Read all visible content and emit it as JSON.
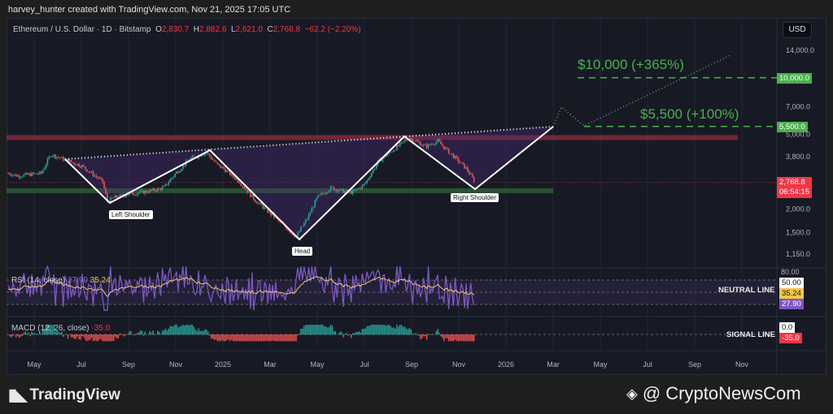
{
  "credit": "harvey_hunter created with TradingView.com, Nov 21, 2025 17:05 UTC",
  "legend": {
    "symbol": "Ethereum / U.S. Dollar · 1D · Bitstamp",
    "o_label": "O",
    "o": "2,830.7",
    "h_label": "H",
    "h": "2,882.6",
    "l_label": "L",
    "l": "2,621.0",
    "c_label": "C",
    "c": "2,768.8",
    "change": "−62.2 (−2.20%)"
  },
  "currency": "USD",
  "price_axis": [
    "14,000.0",
    "7,000.0",
    "5,000.0",
    "3,800.0",
    "2,000.0",
    "1,500.0",
    "1,150.0"
  ],
  "price_tags": {
    "target1": "10,000.0",
    "target2": "5,500.0",
    "last": "2,768.8",
    "countdown": "06:54:15"
  },
  "annotations": {
    "target1": "$10,000 (+365%)",
    "target2": "$5,500 (+100%)",
    "left_shoulder": "Left Shoulder",
    "head": "Head",
    "right_shoulder": "Right Shoulder",
    "neutral_line": "NEUTRAL LINE",
    "signal_line": "SIGNAL LINE"
  },
  "rsi": {
    "title": "RSI (14, close)",
    "value": "27.90",
    "ma": "35.24",
    "axis_top": "80.00",
    "neutral": "50.00"
  },
  "macd": {
    "title": "MACD (12, 26, close)",
    "value": "-35.0",
    "zero": "0.0"
  },
  "time_axis": [
    "May",
    "Jul",
    "Sep",
    "Nov",
    "2025",
    "Mar",
    "May",
    "Jul",
    "Sep",
    "Nov",
    "2026",
    "Mar",
    "May",
    "Jul",
    "Sep",
    "Nov"
  ],
  "footer": {
    "brand": "TradingView",
    "watermark": "@ CryptoNewsCom"
  },
  "colors": {
    "up": "#26a69a",
    "down": "#ef5350",
    "target": "#4caf50",
    "rsi": "#7e57c2",
    "last": "#f23645"
  },
  "chart_data": {
    "type": "candlestick",
    "title": "Ethereum / U.S. Dollar · 1D · Bitstamp",
    "scale": "log",
    "ylim": [
      1100,
      16000
    ],
    "x_unit": "months since May 2024",
    "close_path": [
      [
        -1.1,
        3100
      ],
      [
        -0.7,
        3000
      ],
      [
        0.3,
        3100
      ],
      [
        0.7,
        3900
      ],
      [
        1.2,
        3700
      ],
      [
        2.0,
        3400
      ],
      [
        2.9,
        2800
      ],
      [
        3.1,
        2200
      ],
      [
        3.4,
        2300
      ],
      [
        4,
        2400
      ],
      [
        5,
        2500
      ],
      [
        5.5,
        2600
      ],
      [
        6,
        3100
      ],
      [
        6.6,
        3700
      ],
      [
        7.3,
        4000
      ],
      [
        7.8,
        3400
      ],
      [
        8,
        3300
      ],
      [
        8.7,
        2800
      ],
      [
        9.4,
        2200
      ],
      [
        10,
        1900
      ],
      [
        11.1,
        1420
      ],
      [
        11.6,
        1800
      ],
      [
        12,
        2300
      ],
      [
        12.6,
        2600
      ],
      [
        13,
        2500
      ],
      [
        13.5,
        2450
      ],
      [
        14,
        2700
      ],
      [
        14.6,
        3600
      ],
      [
        15.3,
        4200
      ],
      [
        15.9,
        4800
      ],
      [
        16.6,
        4300
      ],
      [
        17.1,
        4600
      ],
      [
        17.6,
        4000
      ],
      [
        18.3,
        3300
      ],
      [
        18.7,
        2769
      ]
    ],
    "levels": {
      "resistance": 4800,
      "support": 2500,
      "target1": 10000,
      "target2": 5500,
      "last": 2768.8
    }
  }
}
